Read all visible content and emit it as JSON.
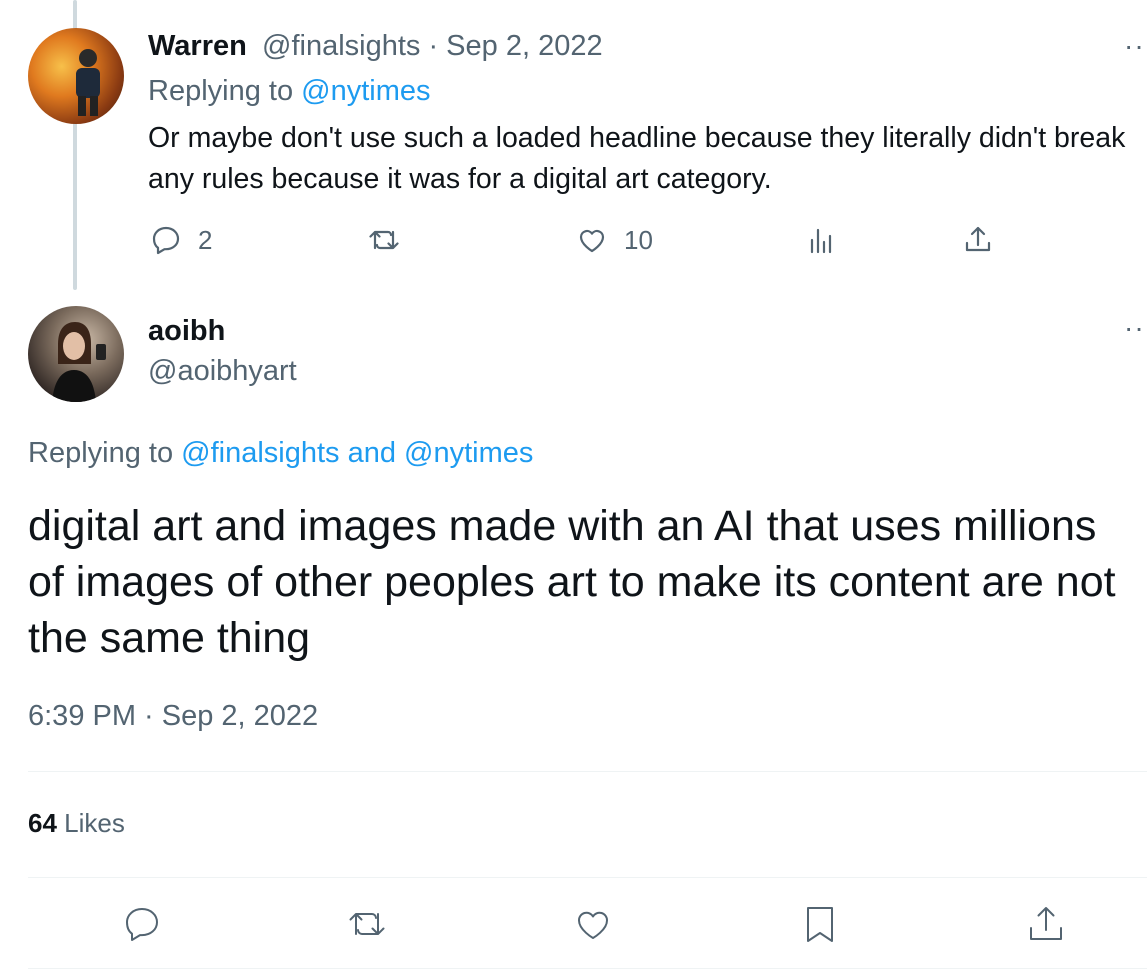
{
  "reply_tweet": {
    "name": "Warren",
    "handle_date": "@finalsights · Sep 2, 2022",
    "replying_prefix": "Replying to ",
    "replying_to": "@nytimes",
    "text": "Or maybe don't use such a loaded headline because they literally didn't break any rules because it was for a digital art category.",
    "reply_count": "2",
    "retweet_count": "",
    "like_count": "10",
    "more": "··"
  },
  "main_tweet": {
    "name": "aoibh",
    "handle": "@aoibhyart",
    "replying_prefix": "Replying to ",
    "replying_to": "@finalsights and @nytimes",
    "text": "digital art and images made with an AI that uses millions of images of other peoples art to make its content are not the same thing",
    "timestamp": "6:39 PM · Sep 2, 2022",
    "likes_count": "64",
    "likes_label": " Likes",
    "more": "··"
  },
  "colors": {
    "link": "#1d9bf0",
    "secondary": "#536471",
    "text": "#0f1419"
  }
}
